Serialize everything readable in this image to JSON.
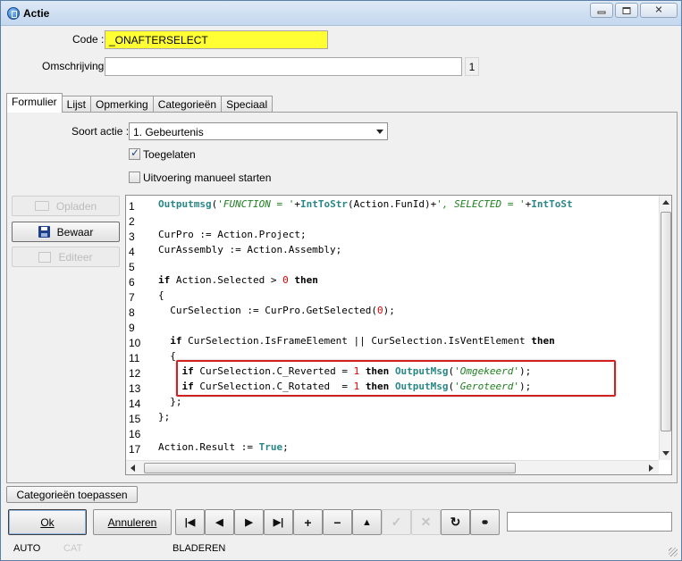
{
  "window": {
    "title": "Actie"
  },
  "form": {
    "code_label": "Code :",
    "code_value": "_ONAFTERSELECT",
    "description_label": "Omschrijving :",
    "description_value": "",
    "description_count": "1"
  },
  "tabs": [
    {
      "label": "Formulier",
      "active": true
    },
    {
      "label": "Lijst",
      "active": false
    },
    {
      "label": "Opmerking",
      "active": false
    },
    {
      "label": "Categorieën",
      "active": false
    },
    {
      "label": "Speciaal",
      "active": false
    }
  ],
  "formulier": {
    "soort_label": "Soort actie :",
    "soort_value": "1.  Gebeurtenis",
    "toegelaten_label": "Toegelaten",
    "toegelaten_checked": true,
    "manueel_label": "Uitvoering manueel starten",
    "manueel_checked": false,
    "buttons": {
      "upload": "Opladen",
      "save": "Bewaar",
      "edit": "Editeer"
    }
  },
  "code_lines": [
    "1",
    "2",
    "3",
    "4",
    "5",
    "6",
    "7",
    "8",
    "9",
    "10",
    "11",
    "12",
    "13",
    "14",
    "15",
    "16",
    "17"
  ],
  "code_text": {
    "l1_fn": "Outputmsg",
    "l1_s1": "'FUNCTION = '",
    "l1_fn2": "IntToStr",
    "l1_arg": "Action.FunId",
    "l1_s2": "', SELECTED = '",
    "l1_fn3": "IntToSt",
    "l3": "CurPro := Action.Project;",
    "l4": "CurAssembly := Action.Assembly;",
    "l6_a": "Action.Selected > ",
    "l6_num": "0",
    "l7": "{",
    "l8_a": "  CurSelection := CurPro.GetSelected(",
    "l8_num": "0",
    "l8_b": ");",
    "l10_a": " CurSelection.IsFrameElement || CurSelection.IsVentElement ",
    "l11": "  {",
    "l12_a": " CurSelection.C_Reverted = ",
    "l12_num": "1",
    "l12_fn": "OutputMsg",
    "l12_str": "'Omgekeerd'",
    "l13_a": " CurSelection.C_Rotated  = ",
    "l13_num": "1",
    "l13_fn": "OutputMsg",
    "l13_str": "'Geroteerd'",
    "l14": "  };",
    "l15": "};",
    "l17_a": "Action.Result := ",
    "l17_kw": "True",
    "kw_if": "if",
    "kw_then": "then"
  },
  "bottom": {
    "apply_label": "Categorieën toepassen",
    "ok_label": "Ok",
    "cancel_label": "Annuleren",
    "search_value": ""
  },
  "status": {
    "mode": "AUTO",
    "cat": "CAT",
    "state": "BLADEREN"
  },
  "colors": {
    "code_field": "#ffff33",
    "highlight_border": "#d02020",
    "keyword_fn": "#2a8787",
    "string": "#208020",
    "number": "#e00000"
  }
}
